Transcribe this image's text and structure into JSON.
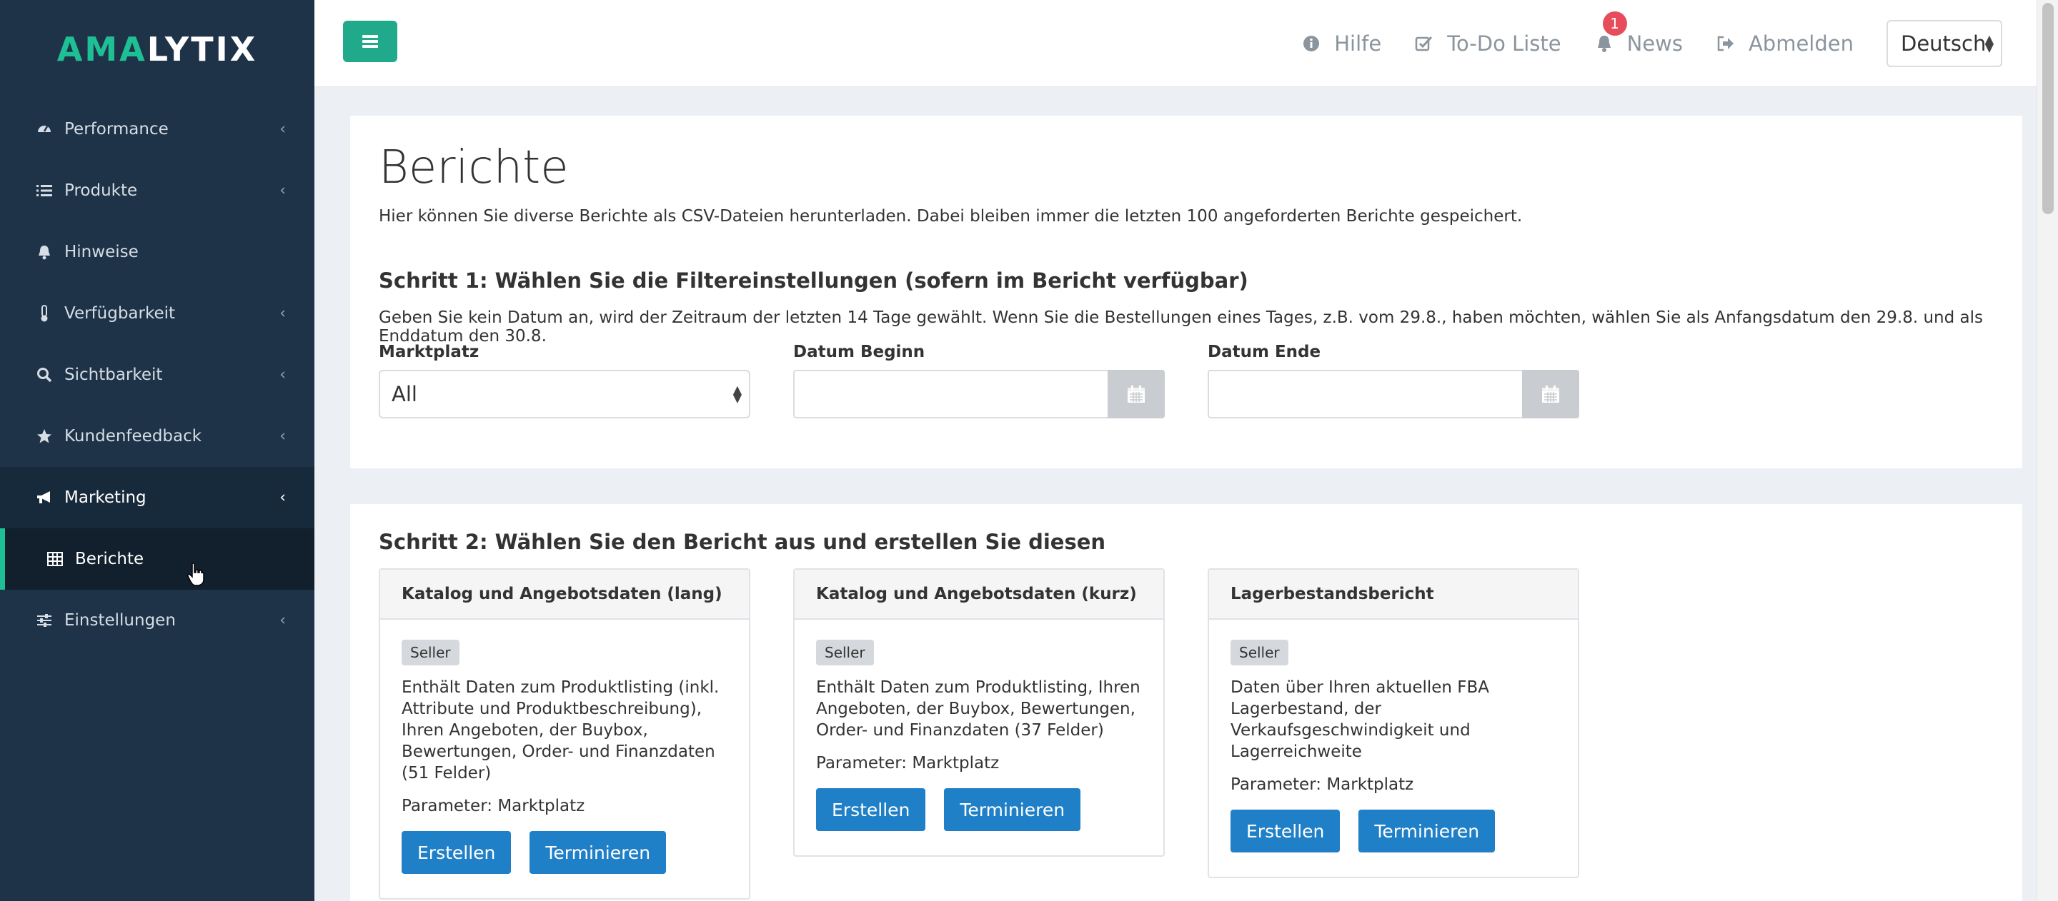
{
  "logo": {
    "part1": "AMA",
    "part2": "LYTIX"
  },
  "sidebar": {
    "items": [
      {
        "label": "Performance",
        "icon": "dashboard-icon"
      },
      {
        "label": "Produkte",
        "icon": "list-icon"
      },
      {
        "label": "Hinweise",
        "icon": "bell-icon"
      },
      {
        "label": "Verfügbarkeit",
        "icon": "thermometer-icon"
      },
      {
        "label": "Sichtbarkeit",
        "icon": "search-icon"
      },
      {
        "label": "Kundenfeedback",
        "icon": "star-icon"
      },
      {
        "label": "Marketing",
        "icon": "bullhorn-icon"
      },
      {
        "label": "Einstellungen",
        "icon": "sliders-icon"
      }
    ],
    "sub_item": {
      "label": "Berichte",
      "icon": "table-icon"
    }
  },
  "header": {
    "help": "Hilfe",
    "todo": "To-Do Liste",
    "news": "News",
    "news_badge": "1",
    "logout": "Abmelden",
    "language": "Deutsch"
  },
  "main": {
    "title": "Berichte",
    "description": "Hier können Sie diverse Berichte als CSV-Dateien herunterladen. Dabei bleiben immer die letzten 100 angeforderten Berichte gespeichert.",
    "step1": {
      "title": "Schritt 1: Wählen Sie die Filtereinstellungen (sofern im Bericht verfügbar)",
      "description": "Geben Sie kein Datum an, wird der Zeitraum der letzten 14 Tage gewählt. Wenn Sie die Bestellungen eines Tages, z.B. vom 29.8., haben möchten, wählen Sie als Anfangsdatum den 29.8. und als Enddatum den 30.8.",
      "marketplace_label": "Marktplatz",
      "marketplace_value": "All",
      "date_start_label": "Datum Beginn",
      "date_end_label": "Datum Ende"
    },
    "step2": {
      "title": "Schritt 2: Wählen Sie den Bericht aus und erstellen Sie diesen",
      "cards": [
        {
          "title": "Katalog und Angebotsdaten (lang)",
          "tag": "Seller",
          "text": "Enthält Daten zum Produktlisting (inkl. Attribute und Produktbeschreibung), Ihren Angeboten, der Buybox, Bewertungen, Order- und Finanzdaten (51 Felder)",
          "param": "Parameter: Marktplatz",
          "create": "Erstellen",
          "schedule": "Terminieren"
        },
        {
          "title": "Katalog und Angebotsdaten (kurz)",
          "tag": "Seller",
          "text": "Enthält Daten zum Produktlisting, Ihren Angeboten, der Buybox, Bewertungen, Order- und Finanzdaten (37 Felder)",
          "param": "Parameter: Marktplatz",
          "create": "Erstellen",
          "schedule": "Terminieren"
        },
        {
          "title": "Lagerbestandsbericht",
          "tag": "Seller",
          "text": "Daten über Ihren aktuellen FBA Lagerbestand, der Verkaufsgeschwindigkeit und Lagerreichweite",
          "param": "Parameter: Marktplatz",
          "create": "Erstellen",
          "schedule": "Terminieren"
        }
      ]
    }
  },
  "colors": {
    "sidebar": "#1e3348",
    "accent": "#1fbf95",
    "primary_button": "#1f7fc7",
    "badge": "#e74c5a"
  }
}
